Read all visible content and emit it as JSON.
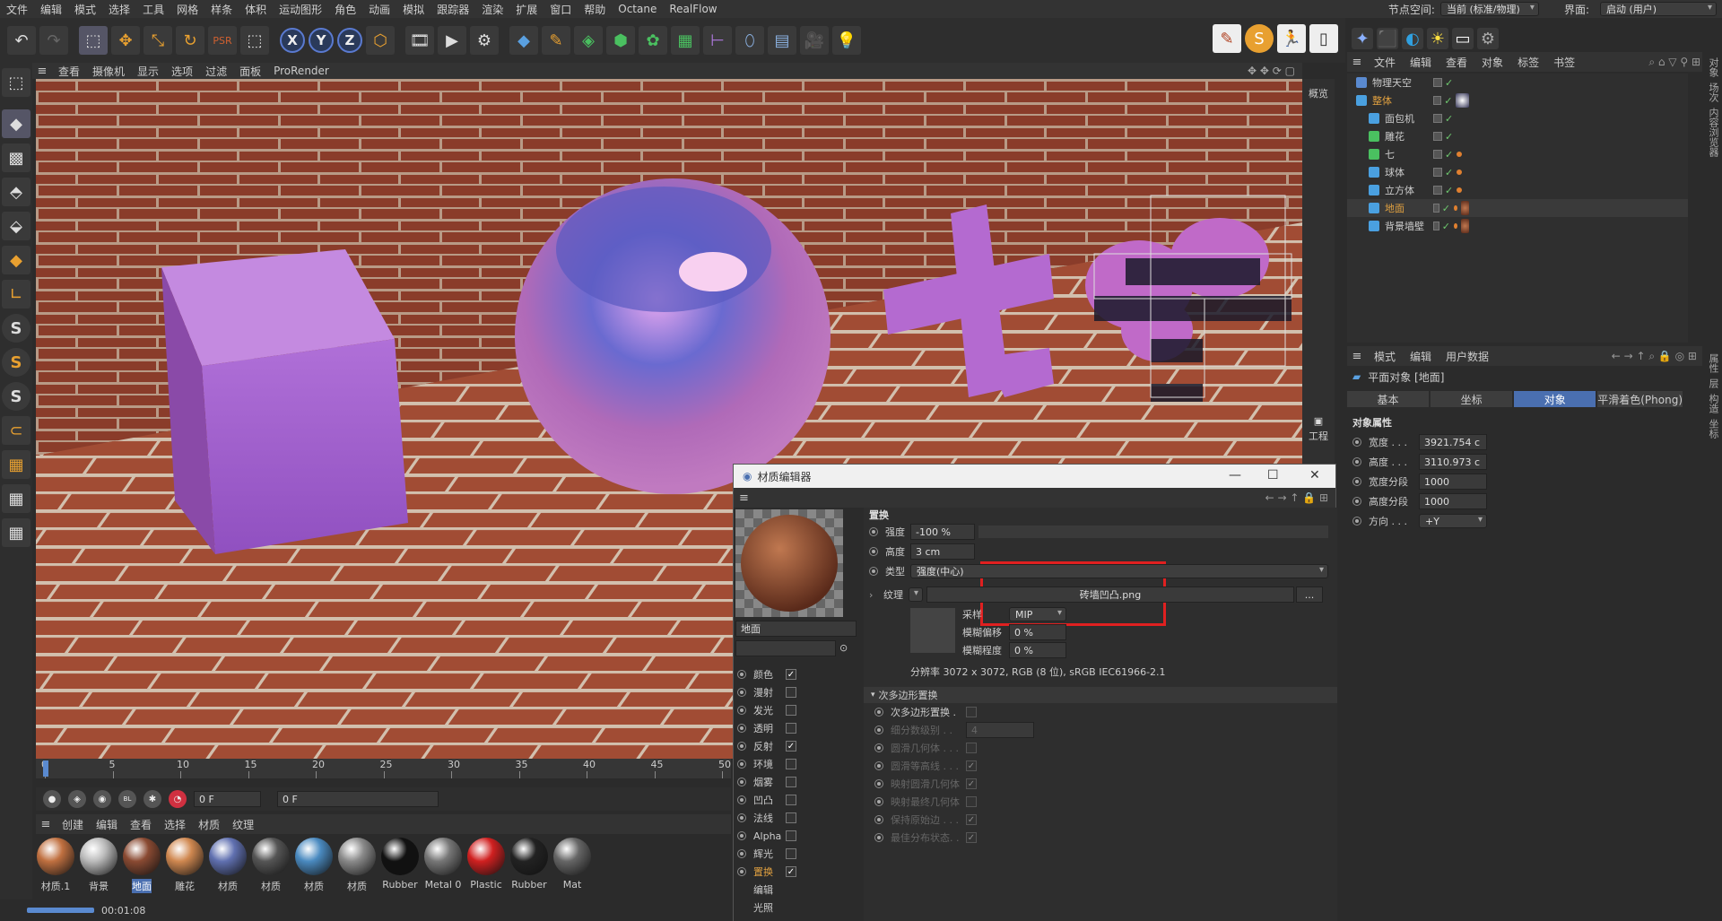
{
  "menubar": {
    "items": [
      "文件",
      "编辑",
      "模式",
      "选择",
      "工具",
      "网格",
      "样条",
      "体积",
      "运动图形",
      "角色",
      "动画",
      "模拟",
      "跟踪器",
      "渲染",
      "扩展",
      "窗口",
      "帮助",
      "Octane",
      "RealFlow"
    ],
    "nodespace_label": "节点空间:",
    "nodespace_value": "当前 (标准/物理)",
    "layout_label": "界面:",
    "layout_value": "启动 (用户)"
  },
  "viewport": {
    "menu": [
      "查看",
      "摄像机",
      "显示",
      "选项",
      "过滤",
      "面板",
      "ProRender"
    ],
    "side_labels": {
      "top": "概览",
      "bottom": "工程"
    },
    "colors": {
      "brick": "#9a4a32",
      "mortar": "#c8b8a8",
      "purple": "#b070d0"
    }
  },
  "timeline": {
    "ticks": [
      "0",
      "5",
      "10",
      "15",
      "20",
      "25",
      "30",
      "35",
      "40",
      "45",
      "50"
    ],
    "frame_field": "0 F",
    "frame_field2": "0 F"
  },
  "material_manager": {
    "menu": [
      "创建",
      "编辑",
      "查看",
      "选择",
      "材质",
      "纹理"
    ],
    "materials": [
      {
        "label": "材质.1",
        "color": "#c07040"
      },
      {
        "label": "背景",
        "color": "#bbbbbb"
      },
      {
        "label": "地面",
        "color": "#8a4a32",
        "selected": true
      },
      {
        "label": "雕花",
        "color": "#d08850"
      },
      {
        "label": "材质",
        "color": "#6070b0"
      },
      {
        "label": "材质",
        "color": "#555555"
      },
      {
        "label": "材质",
        "color": "#4a8ac0"
      },
      {
        "label": "材质",
        "color": "#8a8a8a"
      },
      {
        "label": "Rubber",
        "color": "#111111"
      },
      {
        "label": "Metal 0",
        "color": "#777777"
      },
      {
        "label": "Plastic",
        "color": "#d02020"
      },
      {
        "label": "Rubber",
        "color": "#222222"
      },
      {
        "label": "Mat",
        "color": "#666666"
      }
    ]
  },
  "statusbar": {
    "time": "00:01:08"
  },
  "object_manager": {
    "menu": [
      "文件",
      "编辑",
      "查看",
      "对象",
      "标签",
      "书签"
    ],
    "objects": [
      {
        "name": "物理天空",
        "icon_color": "#5a8ad0",
        "tags": [
          "sky"
        ]
      },
      {
        "name": "整体",
        "icon_color": "#4aa0e0",
        "tags": [
          "sphere-tag"
        ],
        "highlight": true
      },
      {
        "name": "面包机",
        "icon_color": "#4aa0e0",
        "tags": []
      },
      {
        "name": "雕花",
        "icon_color": "#4ac060",
        "tags": []
      },
      {
        "name": "七",
        "icon_color": "#4ac060",
        "tags": [
          "dots"
        ]
      },
      {
        "name": "球体",
        "icon_color": "#4aa0e0",
        "tags": [
          "dots"
        ]
      },
      {
        "name": "立方体",
        "icon_color": "#4aa0e0",
        "tags": [
          "dots"
        ]
      },
      {
        "name": "地面",
        "icon_color": "#4aa0e0",
        "tags": [
          "dots",
          "mat"
        ],
        "selected": true
      },
      {
        "name": "背景墙壁",
        "icon_color": "#4aa0e0",
        "tags": [
          "dots",
          "mat"
        ]
      }
    ]
  },
  "right_vtabs": [
    "对象",
    "场次",
    "内容浏览器"
  ],
  "right_vtabs2": [
    "属性",
    "层",
    "构造",
    "坐标"
  ],
  "attributes": {
    "menu": [
      "模式",
      "编辑",
      "用户数据"
    ],
    "title": "平面对象 [地面]",
    "tabs": [
      "基本",
      "坐标",
      "对象",
      "平滑着色(Phong)"
    ],
    "section": "对象属性",
    "props": [
      {
        "label": "宽度 . . .",
        "value": "3921.754 c"
      },
      {
        "label": "高度 . . .",
        "value": "3110.973 c"
      },
      {
        "label": "宽度分段",
        "value": "1000"
      },
      {
        "label": "高度分段",
        "value": "1000"
      },
      {
        "label": "方向 . . .",
        "value": "+Y"
      }
    ]
  },
  "material_editor": {
    "title": "材质编辑器",
    "name_field": "地面",
    "channels": [
      {
        "label": "颜色",
        "checked": true
      },
      {
        "label": "漫射",
        "checked": false
      },
      {
        "label": "发光",
        "checked": false
      },
      {
        "label": "透明",
        "checked": false
      },
      {
        "label": "反射",
        "checked": true
      },
      {
        "label": "环境",
        "checked": false
      },
      {
        "label": "烟雾",
        "checked": false
      },
      {
        "label": "凹凸",
        "checked": false
      },
      {
        "label": "法线",
        "checked": false
      },
      {
        "label": "Alpha",
        "checked": false
      },
      {
        "label": "辉光",
        "checked": false
      },
      {
        "label": "置换",
        "checked": true,
        "active": true
      },
      {
        "label": "编辑"
      },
      {
        "label": "光照"
      }
    ],
    "section_title": "置换",
    "strength_label": "强度",
    "strength_value": "-100 %",
    "height_label": "高度",
    "height_value": "3 cm",
    "type_label": "类型",
    "type_value": "强度(中心)",
    "texture_label": "纹理",
    "texture_file": "砖墙凹凸.png",
    "texture_more": "...",
    "sampling_label": "采样",
    "sampling_value": "MIP",
    "blur_offset_label": "模糊偏移",
    "blur_offset_value": "0 %",
    "blur_scale_label": "模糊程度",
    "blur_scale_value": "0 %",
    "resolution": "分辨率 3072 x 3072, RGB (8 位), sRGB IEC61966-2.1",
    "subpoly_section": "次多边形置换",
    "subpoly_rows": [
      {
        "label": "次多边形置换 .",
        "enabled": true,
        "checked": false
      },
      {
        "label": "细分数级别 . .",
        "value": "4",
        "enabled": false
      },
      {
        "label": "圆滑几何体 . . .",
        "enabled": false,
        "checked": false
      },
      {
        "label": "圆滑等高线 . . .",
        "enabled": false,
        "checked": true
      },
      {
        "label": "映射圆滑几何体",
        "enabled": false,
        "checked": true
      },
      {
        "label": "映射最终几何体",
        "enabled": false,
        "checked": false
      },
      {
        "label": "保持原始边 . . .",
        "enabled": false,
        "checked": true
      },
      {
        "label": "最佳分布状态. .",
        "enabled": false,
        "checked": true
      }
    ]
  }
}
